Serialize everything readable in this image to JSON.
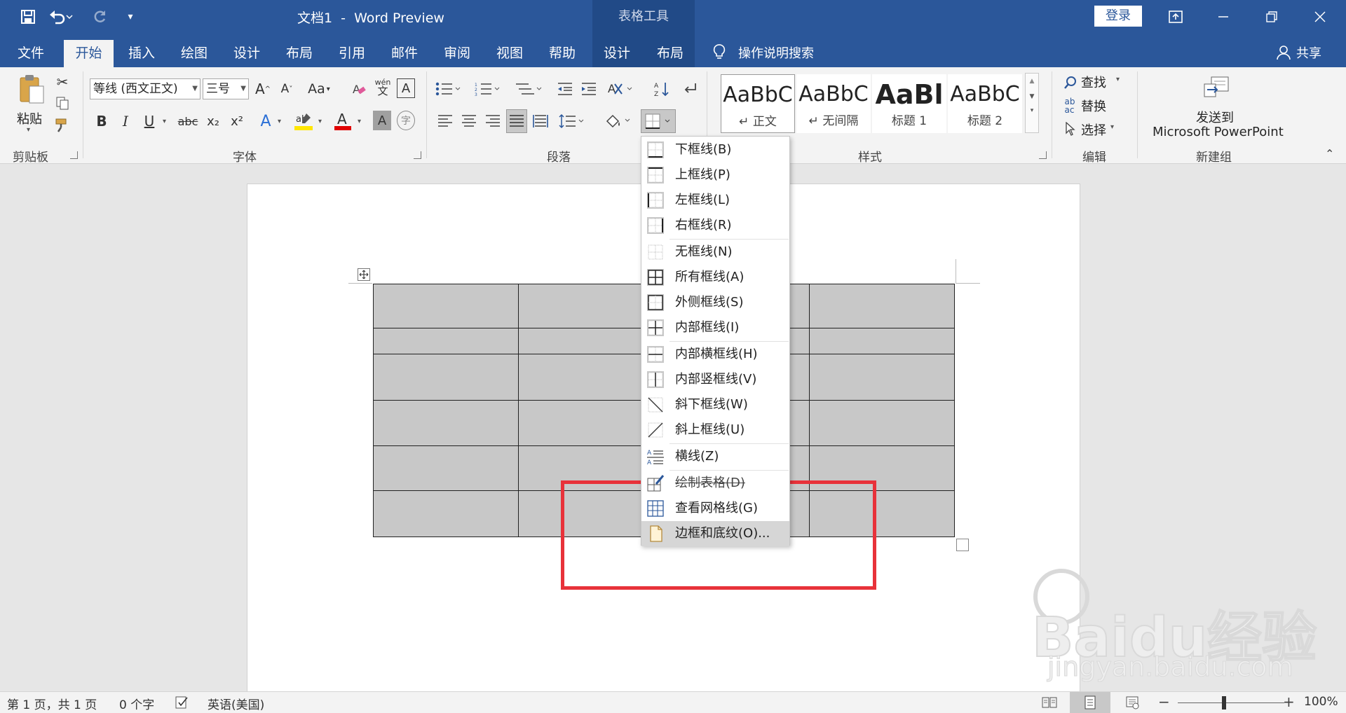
{
  "window": {
    "title": "文档1  -  Word Preview",
    "context_title": "表格工具",
    "login": "登录"
  },
  "qat": {
    "save": "save-icon",
    "undo": "undo-icon",
    "redo": "redo-icon",
    "customize": "▾"
  },
  "tabs": [
    {
      "label": "文件"
    },
    {
      "label": "开始"
    },
    {
      "label": "插入"
    },
    {
      "label": "绘图"
    },
    {
      "label": "设计"
    },
    {
      "label": "布局"
    },
    {
      "label": "引用"
    },
    {
      "label": "邮件"
    },
    {
      "label": "审阅"
    },
    {
      "label": "视图"
    },
    {
      "label": "帮助"
    },
    {
      "label": "设计"
    },
    {
      "label": "布局"
    }
  ],
  "tell_me": "操作说明搜索",
  "share": "共享",
  "ribbon": {
    "clipboard": {
      "label": "剪贴板",
      "paste": "粘贴"
    },
    "font": {
      "label": "字体",
      "font_name": "等线 (西文正文)",
      "font_size": "三号",
      "aa": "Aa",
      "bold": "B",
      "italic": "I",
      "underline": "U",
      "strike": "abc",
      "sub": "x₂",
      "sup": "x²",
      "phonetic_top": "wén",
      "phonetic_bottom": "文",
      "char_border": "A"
    },
    "paragraph": {
      "label": "段落"
    },
    "styles": {
      "label": "样式",
      "items": [
        {
          "sample": "AaBbC",
          "name": "↵ 正文"
        },
        {
          "sample": "AaBbC",
          "name": "↵ 无间隔"
        },
        {
          "sample": "AaBl",
          "name": "标题 1"
        },
        {
          "sample": "AaBbC",
          "name": "标题 2"
        }
      ]
    },
    "editing": {
      "label": "编辑",
      "find": "查找",
      "replace": "替换",
      "select": "选择"
    },
    "new_group": {
      "label": "新建组",
      "send_line1": "发送到",
      "send_line2": "Microsoft PowerPoint"
    }
  },
  "border_menu": {
    "items": [
      {
        "label": "下框线(B)",
        "icon": "bottom-border-icon"
      },
      {
        "label": "上框线(P)",
        "icon": "top-border-icon"
      },
      {
        "label": "左框线(L)",
        "icon": "left-border-icon"
      },
      {
        "label": "右框线(R)",
        "icon": "right-border-icon"
      },
      {
        "label": "无框线(N)",
        "icon": "no-border-icon"
      },
      {
        "label": "所有框线(A)",
        "icon": "all-borders-icon"
      },
      {
        "label": "外侧框线(S)",
        "icon": "outside-borders-icon"
      },
      {
        "label": "内部框线(I)",
        "icon": "inside-borders-icon"
      },
      {
        "label": "内部横框线(H)",
        "icon": "inside-horizontal-border-icon"
      },
      {
        "label": "内部竖框线(V)",
        "icon": "inside-vertical-border-icon"
      },
      {
        "label": "斜下框线(W)",
        "icon": "diagonal-down-border-icon"
      },
      {
        "label": "斜上框线(U)",
        "icon": "diagonal-up-border-icon"
      },
      {
        "label": "横线(Z)",
        "icon": "horizontal-line-icon"
      },
      {
        "label": "绘制表格(D)",
        "icon": "draw-table-icon"
      },
      {
        "label": "查看网格线(G)",
        "icon": "view-gridlines-icon"
      },
      {
        "label": "边框和底纹(O)...",
        "icon": "borders-shading-icon"
      }
    ]
  },
  "status": {
    "page": "第 1 页，共 1 页",
    "words": "0 个字",
    "language": "英语(美国)",
    "zoom": "100%"
  },
  "watermark": {
    "brand": "Baidu经验",
    "url": "jingyan.baidu.com"
  },
  "colors": {
    "accent": "#2b579a",
    "highlight_box": "#e8323a",
    "cell_fill": "#c8c8c8"
  }
}
